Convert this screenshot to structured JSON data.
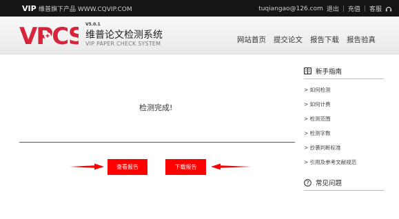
{
  "topbar": {
    "vip_logo": "VIP",
    "brand_text": "维普旗下产品 WWW.CQVIP.COM",
    "user_email": "tuqiangao@126.com",
    "logout": "退出",
    "recharge": "充值",
    "service": "客服"
  },
  "header": {
    "logo_text": "VPCS",
    "version": "V5.0.1",
    "title": "维普论文检测系统",
    "subtitle": "VIP PAPER CHECK SYSTEM",
    "nav": [
      "网站首页",
      "提交论文",
      "报告下载",
      "报告验真"
    ]
  },
  "main": {
    "status": "检测完成!",
    "view_report": "查看报告",
    "download_report": "下载报告"
  },
  "sidebar": {
    "guide_title": "新手指南",
    "guide_items": [
      "> 如何检测",
      "> 如何计费",
      "> 检测范围",
      "> 检测字数",
      "> 抄袭判断标准",
      "> 引用及参考文献规范"
    ],
    "faq_title": "常见问题"
  },
  "colors": {
    "accent_red": "#ff0000",
    "topbar_bg": "#151515",
    "logo_red": "#d6243a"
  }
}
